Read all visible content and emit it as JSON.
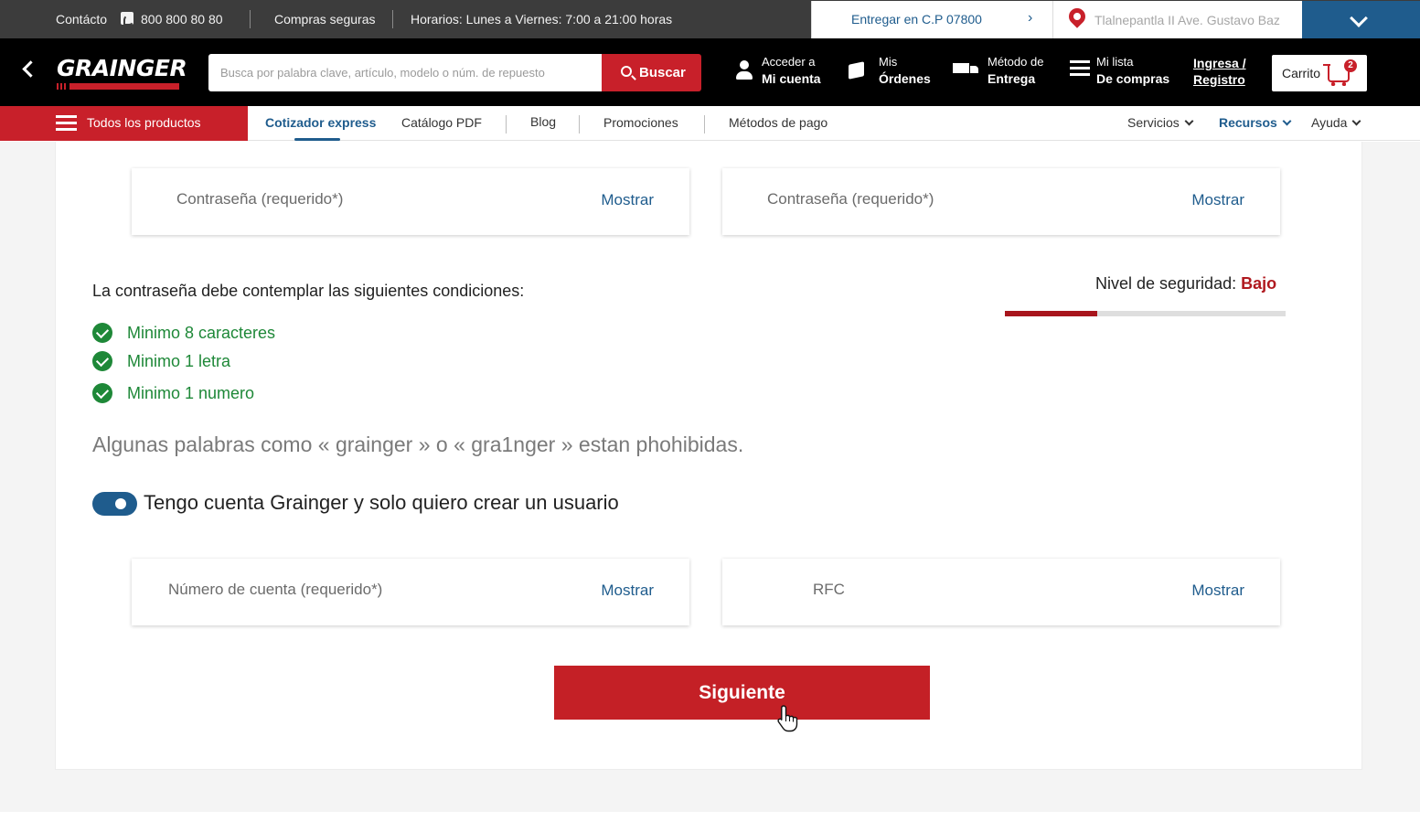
{
  "topbar": {
    "contact": "Contácto",
    "phone": "800 800 80 80",
    "secure": "Compras seguras",
    "hours": "Horarios: Lunes a Viernes: 7:00 a 21:00 horas",
    "deliver": "Entregar en C.P 07800",
    "location": "Tlalnepantla II  Ave. Gustavo Baz"
  },
  "header": {
    "logo": "GRAINGER",
    "search_placeholder": "Busca por palabra clave, artículo, modelo o núm. de repuesto",
    "search_button": "Buscar",
    "account_l1": "Acceder a",
    "account_l2": "Mi cuenta",
    "orders_l1": "Mis",
    "orders_l2": "Órdenes",
    "delivery_l1": "Método de",
    "delivery_l2": "Entrega",
    "list_l1": "Mi lista",
    "list_l2": "De compras",
    "login_l1": "Ingresa /",
    "login_l2": "Registro",
    "cart": "Carrito",
    "cart_count": "2"
  },
  "nav": {
    "all_products": "Todos los productos",
    "links": [
      "Cotizador express",
      "Catálogo PDF",
      "Blog",
      "Promociones",
      "Métodos de pago"
    ],
    "servicios": "Servicios",
    "recursos": "Recursos",
    "ayuda": "Ayuda"
  },
  "form": {
    "password_placeholder": "Contraseña (requerido*)",
    "password_confirm_placeholder": "Contraseña (requerido*)",
    "show_label": "Mostrar",
    "conditions_title": "La contraseña debe contemplar las siguientes condiciones:",
    "security_label": "Nivel de seguridad:",
    "security_value": "Bajo",
    "security_fraction": 0.33,
    "conditions": [
      "Minimo 8 caracteres",
      "Minimo 1 letra",
      "Minimo 1 numero"
    ],
    "note": "Algunas palabras como « grainger » o « gra1nger » estan phohibidas.",
    "toggle_label": "Tengo cuenta Grainger y solo quiero crear un usuario",
    "toggle_on": true,
    "account_placeholder": "Número de cuenta (requerido*)",
    "rfc_placeholder": "RFC",
    "next_button": "Siguiente"
  },
  "colors": {
    "brand_red": "#c8202a",
    "brand_blue": "#1f5c8d",
    "success_green": "#1e8838"
  }
}
